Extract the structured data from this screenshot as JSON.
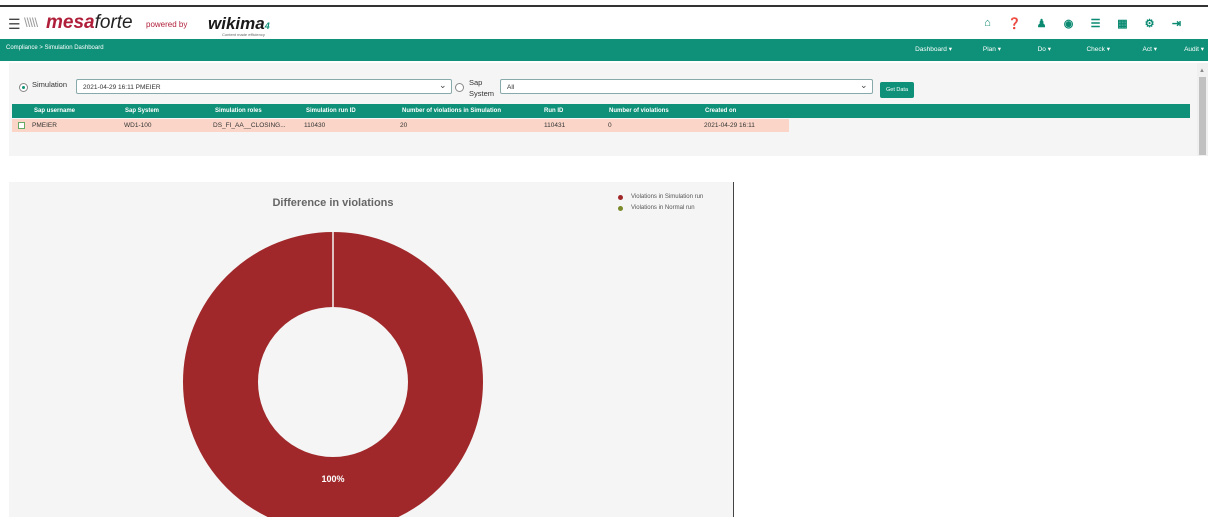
{
  "header": {
    "logo_mark": "\\\\\\\\\\",
    "brand_mesa": "mesa",
    "brand_forte": "forte",
    "powered_by": "powered by",
    "partner": "wikima",
    "partner_suffix": "4",
    "partner_tagline": "Content made efficiency"
  },
  "navbar": {
    "breadcrumb": "Compliance > Simulation Dashboard",
    "menus": [
      "Dashboard",
      "Plan",
      "Do",
      "Check",
      "Act",
      "Audit"
    ]
  },
  "filters": {
    "simulation_label": "Simulation",
    "simulation_value": "2021-04-29 16:11 PMEIER",
    "sap_system_label_1": "Sap",
    "sap_system_label_2": "System",
    "sap_system_value": "All",
    "get_data_label": "Get Data"
  },
  "table": {
    "columns": [
      "Sap username",
      "Sap System",
      "Simulation roles",
      "Simulation run ID",
      "Number of violations in Simulation",
      "Run ID",
      "Number of violations",
      "Created on"
    ],
    "rows": [
      {
        "username": "PMEIER",
        "system": "WD1-100",
        "roles": "DS_FI_AA__CLOSING...",
        "sim_run_id": "110430",
        "sim_violations": "20",
        "run_id": "110431",
        "violations": "0",
        "created": "2021-04-29 16:11"
      }
    ]
  },
  "chart_data": {
    "type": "pie",
    "donut": true,
    "title": "Difference in violations",
    "series": [
      {
        "name": "Violations in Simulation run",
        "value": 20,
        "color": "#a0282a"
      },
      {
        "name": "Violations in Normal run",
        "value": 0,
        "color": "#7a8a2a"
      }
    ],
    "data_label": "100%",
    "legend_position": "top-right"
  },
  "colors": {
    "accent": "#0e9178",
    "row_highlight": "#fbd6c8",
    "donut": "#a0282a"
  }
}
